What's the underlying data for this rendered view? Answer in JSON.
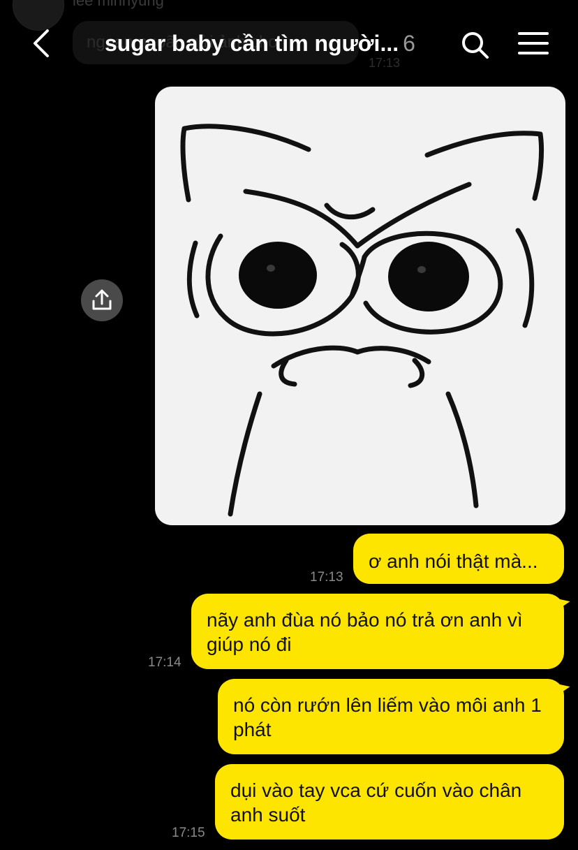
{
  "background_context": {
    "sender_name": "lee minhyung",
    "bubble_text": "ngoan ngoãn gửi ảnh cho",
    "time": "17:13"
  },
  "header": {
    "title": "sugar baby cần tìm người...",
    "member_count": "6",
    "back_icon": "chevron-left-icon",
    "search_icon": "search-icon",
    "menu_icon": "hamburger-menu-icon"
  },
  "image_message": {
    "content": "angry-cat-sticker",
    "share_icon": "share-upload-icon"
  },
  "messages": [
    {
      "text": "ơ anh nói thật mà...",
      "time": "17:13"
    },
    {
      "text": "nãy anh đùa nó bảo nó trả ơn anh vì giúp nó đi",
      "time": "17:14"
    },
    {
      "text": "nó còn rướn lên liếm vào môi anh 1 phát",
      "time": ""
    },
    {
      "text": "dụi vào tay vca cứ cuốn vào chân anh suốt",
      "time": "17:15"
    }
  ],
  "colors": {
    "background": "#000000",
    "my_bubble": "#fee500",
    "bubble_text": "#111111",
    "timestamp": "#8a8a8a",
    "member_count": "#9a9a9a"
  }
}
